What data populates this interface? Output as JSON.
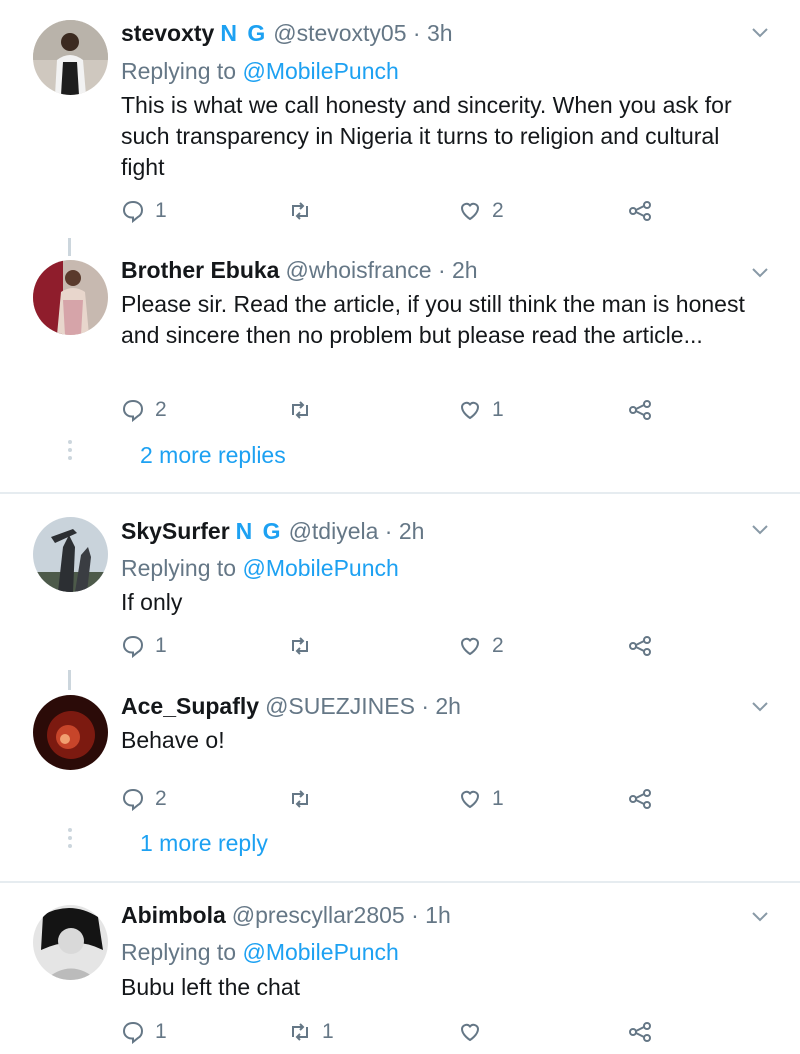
{
  "tweets": [
    {
      "name": "stevoxty",
      "badge": "N G",
      "handle": "@stevoxty05",
      "time": "· 3h",
      "replying_prefix": "Replying to",
      "replying_to": "@MobilePunch",
      "text": "This is what we call honesty and sincerity. When you ask for such transparency in Nigeria it turns to religion and cultural fight",
      "replies": "1",
      "retweets": "",
      "likes": "2"
    },
    {
      "name": "Brother Ebuka",
      "handle": "@whoisfrance",
      "time": "· 2h",
      "text": "Please sir. Read the article, if you still think the man is honest and sincere then no problem but please read the article...",
      "replies": "2",
      "retweets": "",
      "likes": "1"
    },
    {
      "name": "SkySurfer",
      "badge": "N G",
      "handle": "@tdiyela",
      "time": "· 2h",
      "replying_prefix": "Replying to",
      "replying_to": "@MobilePunch",
      "text": "If only",
      "replies": "1",
      "retweets": "",
      "likes": "2"
    },
    {
      "name": "Ace_Supafly",
      "handle": "@SUEZJINES",
      "time": "· 2h",
      "text": "Behave o!",
      "replies": "2",
      "retweets": "",
      "likes": "1"
    },
    {
      "name": "Abimbola",
      "handle": "@prescyllar2805",
      "time": "· 1h",
      "replying_prefix": "Replying to",
      "replying_to": "@MobilePunch",
      "text": "Bubu left the chat",
      "replies": "1",
      "retweets": "1",
      "likes": ""
    }
  ],
  "more_replies": [
    "2 more replies",
    "1 more reply"
  ],
  "colors": {
    "accent": "#1da1f2",
    "muted": "#657786",
    "divider": "#e6ecf0",
    "thread": "#ccd6dd"
  },
  "icons": [
    "reply-icon",
    "retweet-icon",
    "like-icon",
    "share-icon",
    "chevron-down-icon"
  ]
}
